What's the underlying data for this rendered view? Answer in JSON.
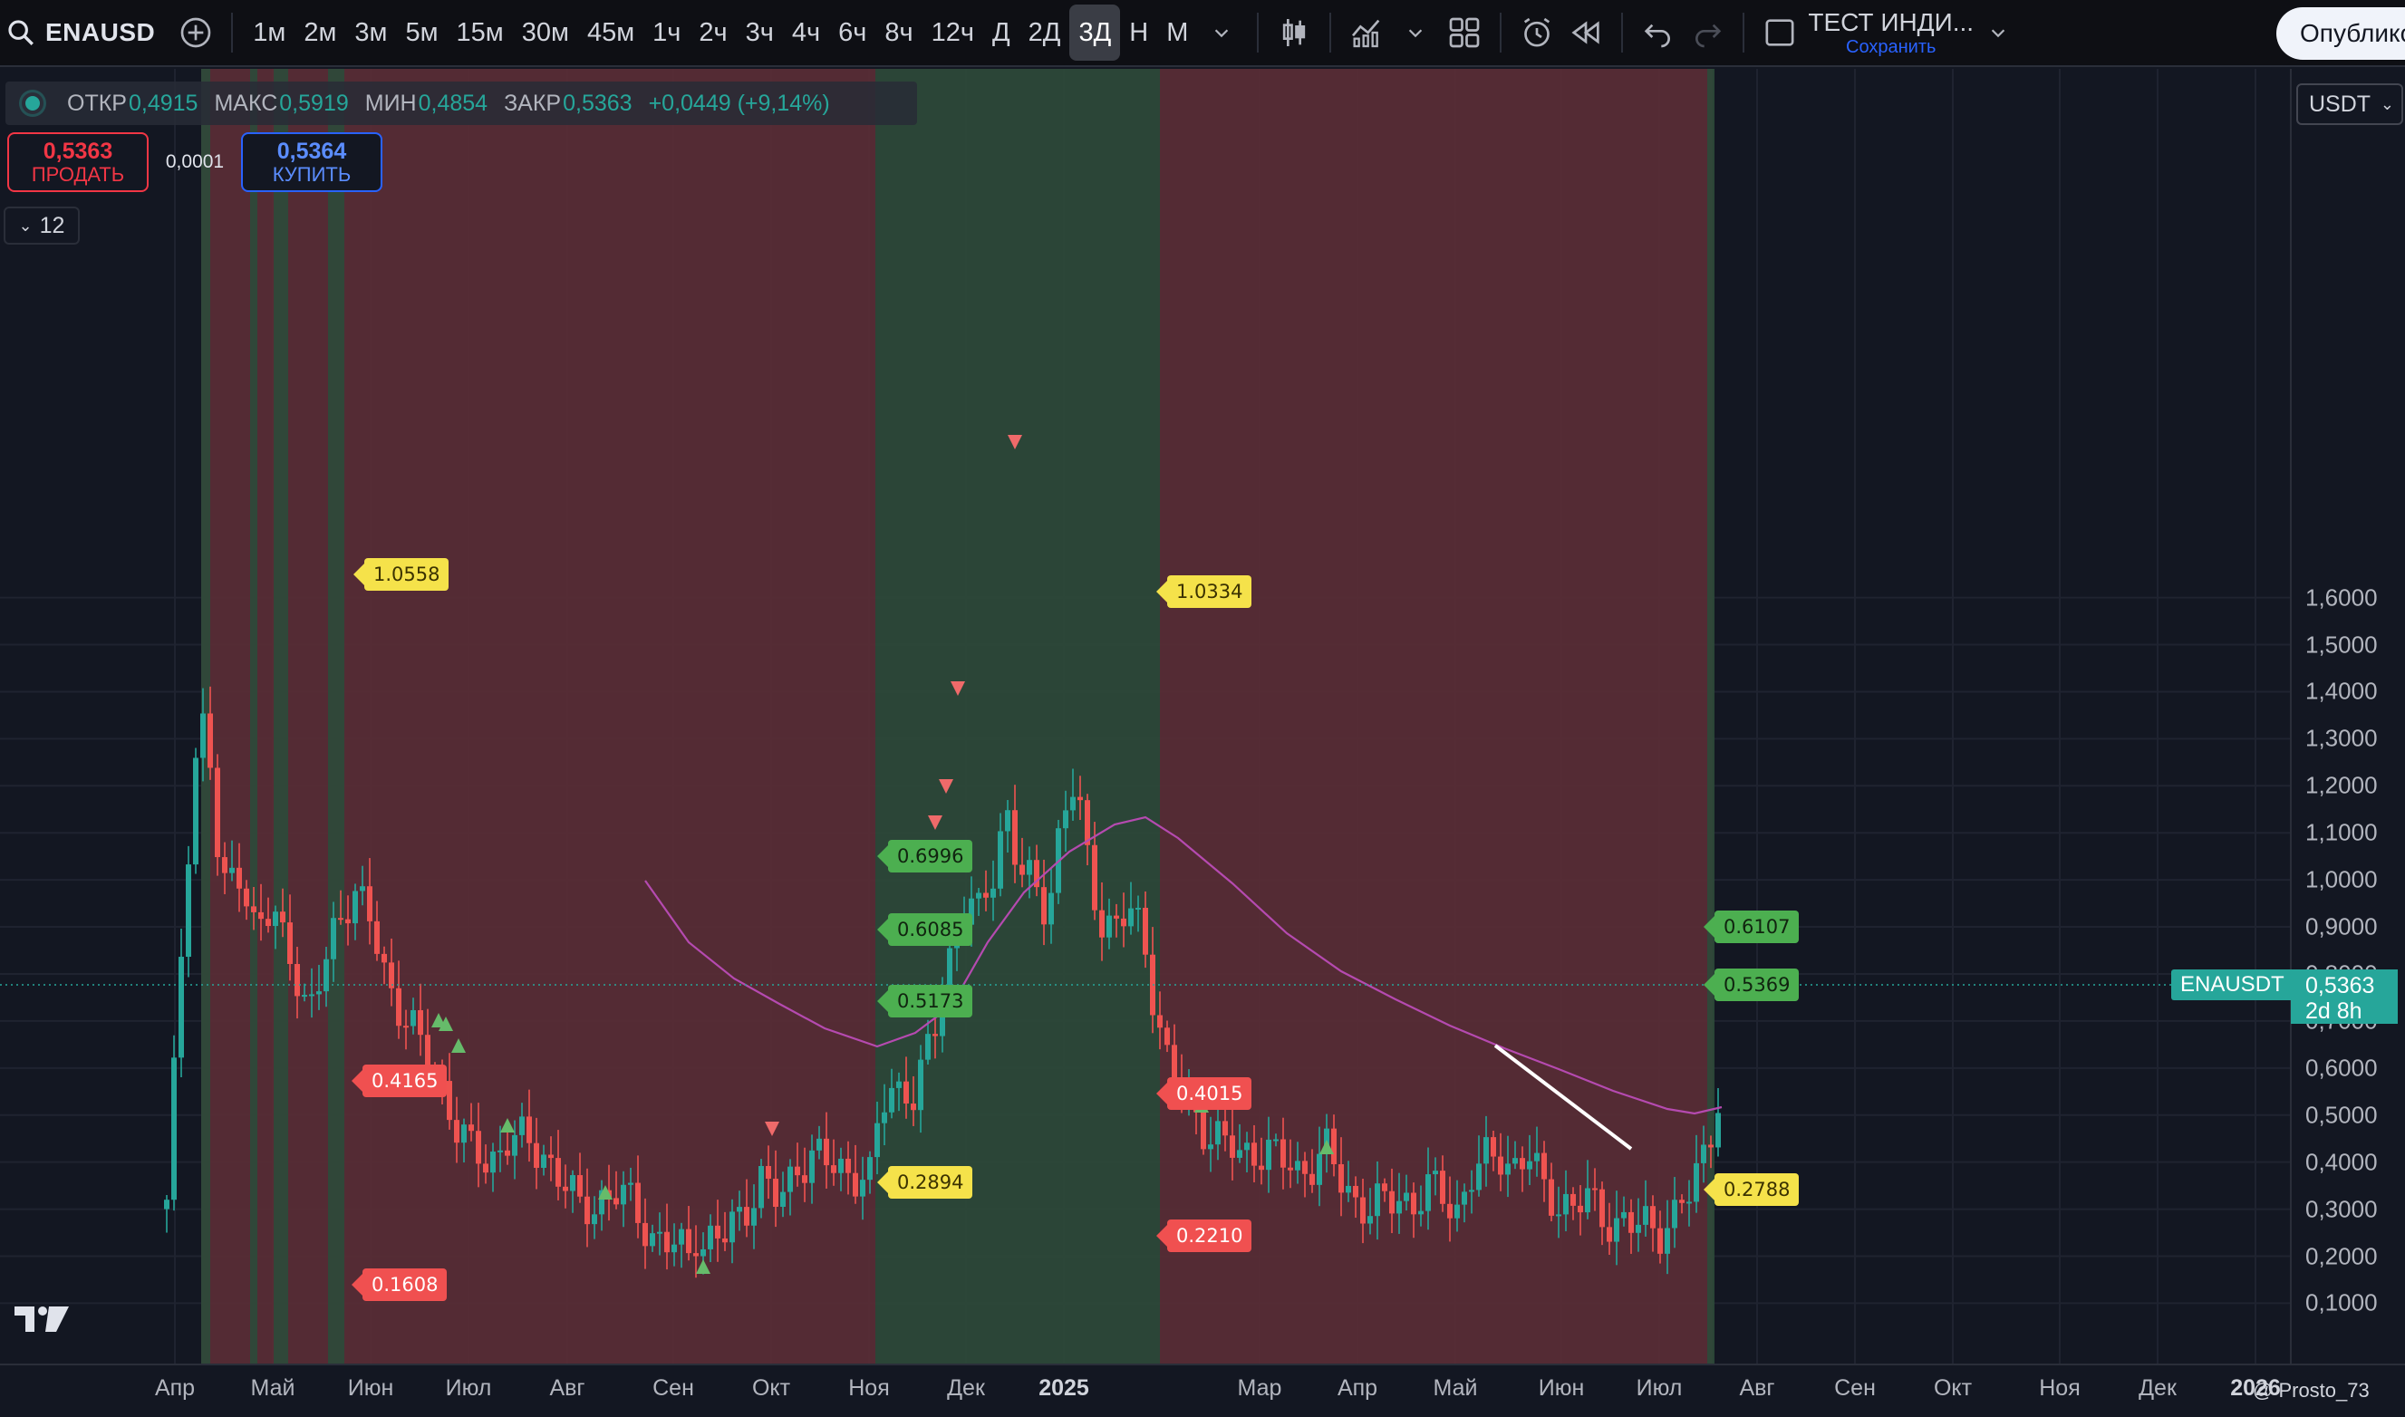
{
  "toolbar": {
    "symbol": "ENAUSD",
    "intervals": [
      "1м",
      "2м",
      "3м",
      "5м",
      "15м",
      "30м",
      "45м",
      "1ч",
      "2ч",
      "3ч",
      "4ч",
      "6ч",
      "8ч",
      "12ч",
      "Д",
      "2Д",
      "3Д",
      "Н",
      "М"
    ],
    "active_interval": "3Д",
    "layout_title": "ТЕСТ ИНДИ...",
    "layout_save": "Сохранить",
    "publish": "Опублико"
  },
  "legend": {
    "open_label": "ОТКР",
    "open": "0,4915",
    "high_label": "МАКС",
    "high": "0,5919",
    "low_label": "МИН",
    "low": "0,4854",
    "close_label": "ЗАКР",
    "close": "0,5363",
    "change": "+0,0449 (+9,14%)"
  },
  "trade": {
    "sell_price": "0,5363",
    "sell_label": "ПРОДАТЬ",
    "spread": "0,0001",
    "buy_price": "0,5364",
    "buy_label": "КУПИТЬ",
    "indicators_count": "12"
  },
  "currency": "USDT",
  "price_axis": [
    "1,6000",
    "1,5000",
    "1,4000",
    "1,3000",
    "1,2000",
    "1,1000",
    "1,0000",
    "0,9000",
    "0,8000",
    "0,7000",
    "0,6000",
    "0,5000",
    "0,4000",
    "0,3000",
    "0,2000",
    "0,1000"
  ],
  "last_price": {
    "symbol": "ENAUSDT",
    "value": "0,5363",
    "countdown": "2d 8h"
  },
  "time_axis": [
    "Апр",
    "Май",
    "Июн",
    "Июл",
    "Авг",
    "Сен",
    "Окт",
    "Ноя",
    "Дек",
    "2025",
    "Мар",
    "Апр",
    "Май",
    "Июн",
    "Июл",
    "Авг",
    "Сен",
    "Окт",
    "Ноя",
    "Дек",
    "2026"
  ],
  "levels": [
    "1.0558",
    "0.4165",
    "0.1608",
    "0.6996",
    "0.6085",
    "0.5173",
    "0.2894",
    "1.0334",
    "0.4015",
    "0.2210",
    "0.6107",
    "0.5369",
    "0.2788"
  ],
  "credit": "@ Prosto_73",
  "colors": {
    "background": "#131722",
    "bull": "#26a69a",
    "bear": "#ef5350",
    "zone_red": "#5a2e36",
    "zone_green": "#2e4a3a",
    "ma": "#b54ab0"
  },
  "chart_data": {
    "type": "candlestick",
    "symbol": "ENAUSDT",
    "timeframe": "3D",
    "x_range": [
      "2024-04",
      "2026-01"
    ],
    "ylim": [
      0.1,
      1.6
    ],
    "log_scale": false,
    "grid": true,
    "last": {
      "open": 0.4915,
      "high": 0.5919,
      "low": 0.4854,
      "close": 0.5363
    },
    "levels": [
      1.0558,
      0.4165,
      0.1608,
      0.6996,
      0.6085,
      0.5173,
      0.2894,
      1.0334,
      0.4015,
      0.221,
      0.6107,
      0.5369,
      0.2788
    ],
    "zones": [
      {
        "color": "red",
        "from": "2024-04",
        "to": "2024-11"
      },
      {
        "color": "green",
        "from": "2024-11",
        "to": "2025-02"
      },
      {
        "color": "red",
        "from": "2025-02",
        "to": "2025-07"
      }
    ]
  }
}
